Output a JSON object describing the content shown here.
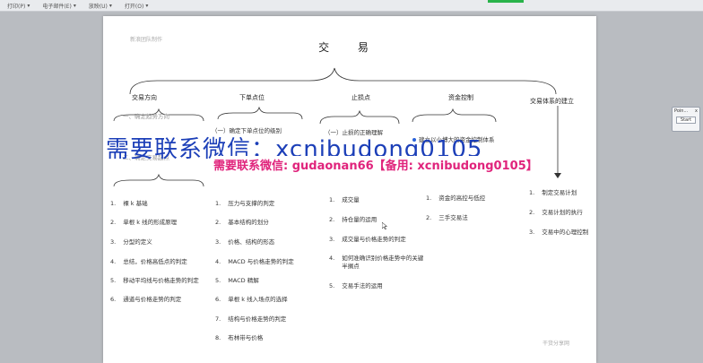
{
  "toolbar": [
    "打印(P)",
    "电子邮件(E)",
    "放映(U)",
    "打开(O)"
  ],
  "doc": {
    "watermark_top": "新浪团队制作",
    "watermark_bottom": "干货分享网",
    "title": "交 易"
  },
  "columns": [
    {
      "header": "交易方向",
      "subs": [
        "一、确定趋势方向",
        "二、确定交易起点"
      ],
      "items": [
        {
          "n": "1.",
          "t": "裸 k 基础"
        },
        {
          "n": "2.",
          "t": "单根 k 线的形成原理"
        },
        {
          "n": "3.",
          "t": "分型的定义"
        },
        {
          "n": "4.",
          "t": "总结，价格高低点的判定"
        },
        {
          "n": "5.",
          "t": "移动平均线与价格走势的判定"
        },
        {
          "n": "6.",
          "t": "通道与价格走势的判定"
        }
      ]
    },
    {
      "header": "下单点位",
      "subs": [
        "（一）确定下单点位的级别"
      ],
      "items": [
        {
          "n": "1.",
          "t": "压力与支撑的判定"
        },
        {
          "n": "2.",
          "t": "基本结构的划分"
        },
        {
          "n": "3.",
          "t": "价格、结构的形态"
        },
        {
          "n": "4.",
          "t": "MACD 与价格走势的判定"
        },
        {
          "n": "5.",
          "t": "MACD 精解"
        },
        {
          "n": "6.",
          "t": "单根 k 线入场点的选择"
        },
        {
          "n": "7.",
          "t": "结构与价格走势的判定"
        },
        {
          "n": "8.",
          "t": "布林带与价格"
        }
      ]
    },
    {
      "header": "止损点",
      "subs": [
        "（一）止损的正确理解"
      ],
      "items": [
        {
          "n": "1.",
          "t": "成交量"
        },
        {
          "n": "2.",
          "t": "持仓量的运用"
        },
        {
          "n": "3.",
          "t": "成交量与价格走势的判定"
        },
        {
          "n": "4.",
          "t": "如何准确识别价格走势中的关键半搁点"
        },
        {
          "n": "5.",
          "t": "交易手法的运用"
        }
      ]
    },
    {
      "header": "资金控制",
      "subs": [
        "建立以小博大的资金控制体系"
      ],
      "items": [
        {
          "n": "1.",
          "t": "资金的高控与低控"
        },
        {
          "n": "2.",
          "t": "三手交易法"
        }
      ]
    },
    {
      "header": "交易体系的建立",
      "subs": [],
      "items": [
        {
          "n": "1.",
          "t": "制定交易计划"
        },
        {
          "n": "2.",
          "t": "交易计划的执行"
        },
        {
          "n": "3.",
          "t": "交易中的心理控制"
        }
      ]
    }
  ],
  "overlay": {
    "line1": "需要联系微信：xcnibudong0105",
    "line2": "需要联系微信: gudaonan66【备用: xcnibudong0105】"
  },
  "point_panel": {
    "title": "Poin...",
    "close": "x",
    "start": "Start"
  }
}
